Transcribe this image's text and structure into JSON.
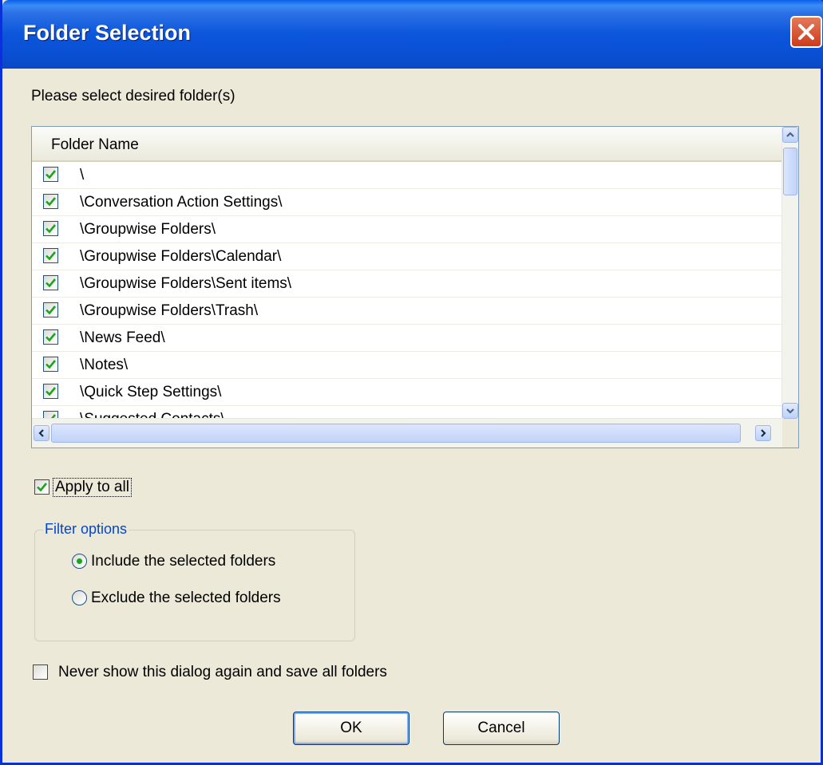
{
  "window": {
    "title": "Folder Selection"
  },
  "prompt": "Please select desired folder(s)",
  "list": {
    "column_header": "Folder Name",
    "rows": [
      {
        "label": "\\",
        "checked": true
      },
      {
        "label": "\\Conversation Action Settings\\",
        "checked": true
      },
      {
        "label": "\\Groupwise Folders\\",
        "checked": true
      },
      {
        "label": "\\Groupwise Folders\\Calendar\\",
        "checked": true
      },
      {
        "label": "\\Groupwise Folders\\Sent items\\",
        "checked": true
      },
      {
        "label": "\\Groupwise Folders\\Trash\\",
        "checked": true
      },
      {
        "label": "\\News Feed\\",
        "checked": true
      },
      {
        "label": "\\Notes\\",
        "checked": true
      },
      {
        "label": "\\Quick Step Settings\\",
        "checked": true
      },
      {
        "label": "\\Suggested Contacts\\",
        "checked": true
      }
    ]
  },
  "apply_to_all": {
    "label": "Apply to all",
    "checked": true
  },
  "filter": {
    "legend": "Filter options",
    "include_label": "Include the selected folders",
    "exclude_label": "Exclude the selected folders",
    "selected": "include"
  },
  "never_show": {
    "label": "Never show this dialog again and save all folders",
    "checked": false
  },
  "buttons": {
    "ok": "OK",
    "cancel": "Cancel"
  },
  "colors": {
    "titlebar": "#0a4fd2",
    "dialog_bg": "#ece9d8",
    "check": "#21a121",
    "legend": "#0046d5"
  }
}
